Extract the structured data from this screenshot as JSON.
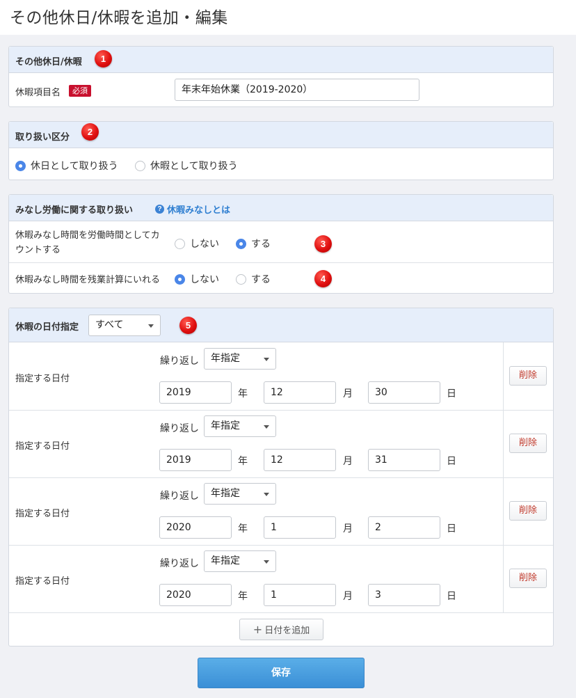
{
  "page": {
    "title": "その他休日/休暇を追加・編集"
  },
  "section1": {
    "title": "その他休日/休暇",
    "badge": "1",
    "field_label": "休暇項目名",
    "required": "必須",
    "name_value": "年末年始休業（2019-2020）"
  },
  "section2": {
    "title": "取り扱い区分",
    "badge": "2",
    "options": [
      "休日として取り扱う",
      "休暇として取り扱う"
    ],
    "selected": "休日として取り扱う"
  },
  "section3": {
    "title": "みなし労働に関する取り扱い",
    "help_link": "休暇みなしとは",
    "row1": {
      "label_line1": "休暇みなし時間を労働時間としてカ",
      "label_line2": "ウントする",
      "options": [
        "しない",
        "する"
      ],
      "selected": "する",
      "badge": "3"
    },
    "row2": {
      "label": "休暇みなし時間を残業計算にいれる",
      "options": [
        "しない",
        "する"
      ],
      "selected": "しない",
      "badge": "4"
    }
  },
  "section4": {
    "title": "休暇の日付指定",
    "scope_value": "すべて",
    "badge": "5",
    "rows": [
      {
        "label": "指定する日付",
        "repeat_label": "繰り返し",
        "repeat_value": "年指定",
        "year": "2019",
        "year_unit": "年",
        "month": "12",
        "month_unit": "月",
        "day": "30",
        "day_unit": "日",
        "delete": "削除"
      },
      {
        "label": "指定する日付",
        "repeat_label": "繰り返し",
        "repeat_value": "年指定",
        "year": "2019",
        "year_unit": "年",
        "month": "12",
        "month_unit": "月",
        "day": "31",
        "day_unit": "日",
        "delete": "削除"
      },
      {
        "label": "指定する日付",
        "repeat_label": "繰り返し",
        "repeat_value": "年指定",
        "year": "2020",
        "year_unit": "年",
        "month": "1",
        "month_unit": "月",
        "day": "2",
        "day_unit": "日",
        "delete": "削除"
      },
      {
        "label": "指定する日付",
        "repeat_label": "繰り返し",
        "repeat_value": "年指定",
        "year": "2020",
        "year_unit": "年",
        "month": "1",
        "month_unit": "月",
        "day": "3",
        "day_unit": "日",
        "delete": "削除"
      }
    ],
    "add_button": "日付を追加"
  },
  "actions": {
    "save": "保存"
  },
  "colors": {
    "accent": "#4a86e8",
    "badge_red": "#e01010",
    "required_red": "#c8102e",
    "header_bg": "#e6eefa"
  },
  "icons": {
    "plus": "plus-icon",
    "help": "help-circle-icon",
    "caret": "caret-down-icon"
  }
}
